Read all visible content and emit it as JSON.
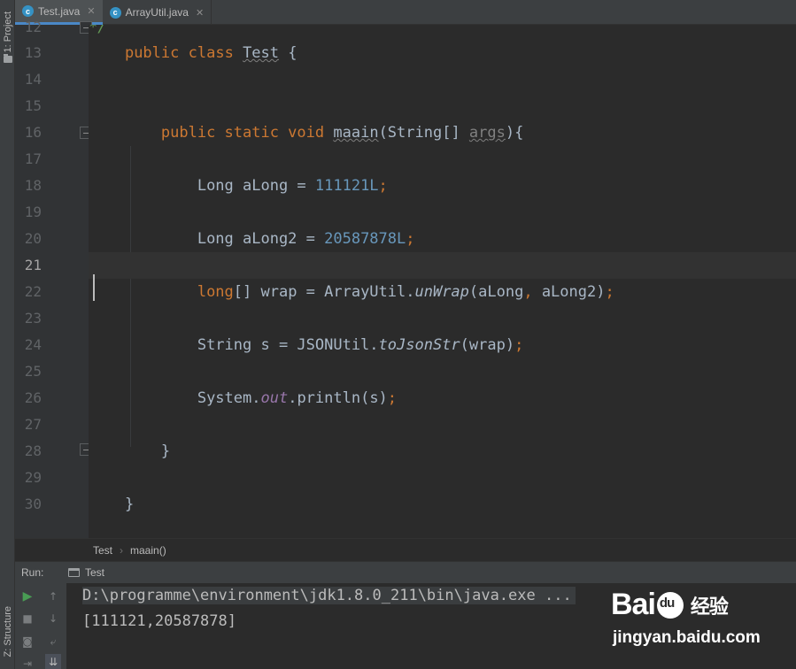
{
  "tool_strip": {
    "project_label": "1: Project",
    "structure_label": "Z: Structure"
  },
  "tabs": [
    {
      "label": "Test.java",
      "active": true,
      "icon": "class-icon"
    },
    {
      "label": "ArrayUtil.java",
      "active": false,
      "icon": "class-icon"
    }
  ],
  "editor": {
    "line_numbers": [
      "12",
      "13",
      "14",
      "15",
      "16",
      "17",
      "18",
      "19",
      "20",
      "21",
      "22",
      "23",
      "24",
      "25",
      "26",
      "27",
      "28",
      "29",
      "30"
    ],
    "current_line": "21",
    "code": {
      "l12_comment": "*/",
      "l13_public": "public",
      "l13_class": "class",
      "l13_name": "Test",
      "l13_brace": " {",
      "l16_mods": "public static void",
      "l16_method": "maain",
      "l16_params_open": "(String[] ",
      "l16_param": "args",
      "l16_params_close": "){",
      "l18_decl": "Long aLong = ",
      "l18_num": "111121L",
      "l20_decl": "Long aLong2 = ",
      "l20_num": "20587878L",
      "l22_type": "long",
      "l22_rest1": "[] wrap = ArrayUtil.",
      "l22_method": "unWrap",
      "l22_args1": "(aLong",
      "l22_comma": ",",
      "l22_args2": " aLong2)",
      "l24_decl": "String s = JSONUtil.",
      "l24_method": "toJsonStr",
      "l24_args": "(wrap)",
      "l26_sys": "System.",
      "l26_field": "out",
      "l26_call": ".println(s)",
      "semicolon": ";",
      "l28_brace": "}",
      "l30_brace": "}"
    }
  },
  "breadcrumb": {
    "class_name": "Test",
    "separator": "›",
    "method_name": "maain()"
  },
  "run_panel": {
    "label": "Run:",
    "tab_label": "Test",
    "console_cmd": "D:\\programme\\environment\\jdk1.8.0_211\\bin\\java.exe ...",
    "console_output": "[111121,20587878]"
  },
  "watermark": {
    "logo_text_a": "Bai",
    "logo_text_b": "du",
    "logo_cn": "经验",
    "url": "jingyan.baidu.com"
  },
  "colors": {
    "background": "#2b2b2b",
    "keyword": "#cc7832",
    "number": "#6897bb",
    "field": "#9876aa",
    "run_green": "#499c54",
    "tab_accent": "#4a88c7"
  }
}
